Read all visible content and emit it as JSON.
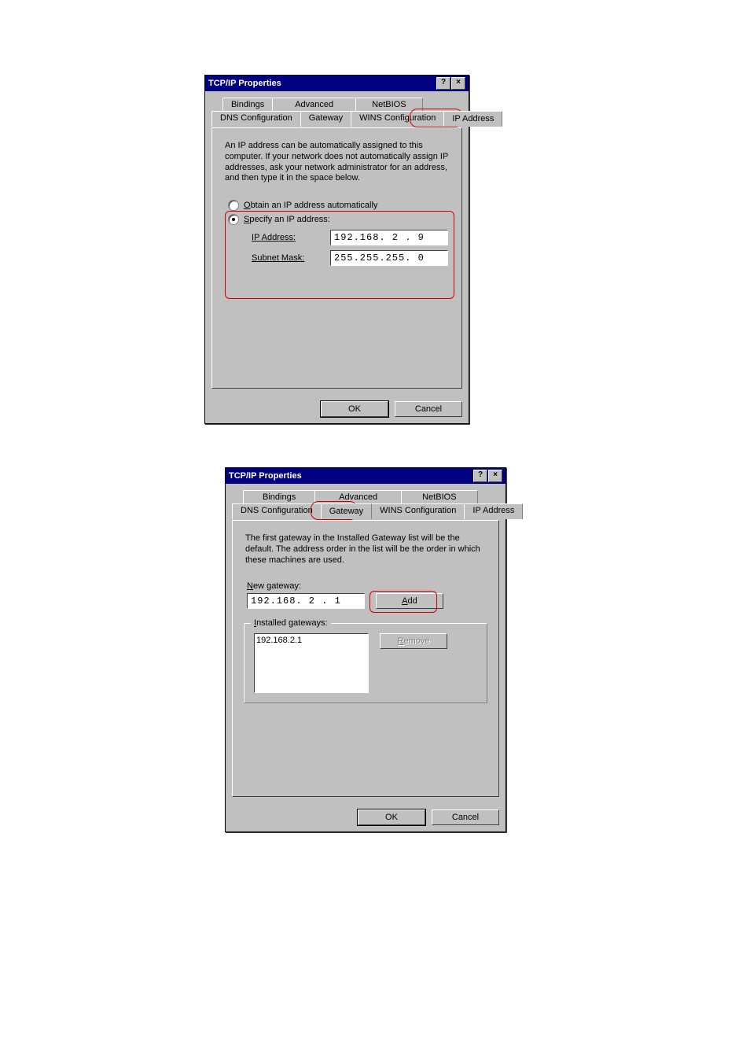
{
  "dialog1": {
    "title": "TCP/IP Properties",
    "tabs_back": [
      "Bindings",
      "Advanced",
      "NetBIOS"
    ],
    "tabs_front": [
      "DNS Configuration",
      "Gateway",
      "WINS Configuration",
      "IP Address"
    ],
    "active_tab": "IP Address",
    "description": "An IP address can be automatically assigned to this computer. If your network does not automatically assign IP addresses, ask your network administrator for an address, and then type it in the space below.",
    "radio_auto": "Obtain an IP address automatically",
    "radio_specify": "Specify an IP address:",
    "ip_label": "IP Address:",
    "ip_value": "192.168. 2 . 9",
    "subnet_label": "Subnet Mask:",
    "subnet_value": "255.255.255. 0",
    "ok": "OK",
    "cancel": "Cancel"
  },
  "dialog2": {
    "title": "TCP/IP Properties",
    "tabs_back": [
      "Bindings",
      "Advanced",
      "NetBIOS"
    ],
    "tabs_front": [
      "DNS Configuration",
      "Gateway",
      "WINS Configuration",
      "IP Address"
    ],
    "active_tab": "Gateway",
    "description": "The first gateway in the Installed Gateway list will be the default. The address order in the list will be the order in which these machines are used.",
    "new_gateway_label": "New gateway:",
    "new_gateway_value": "192.168. 2 . 1",
    "add": "Add",
    "installed_label": "Installed gateways:",
    "installed_item": "192.168.2.1",
    "remove": "Remove",
    "ok": "OK",
    "cancel": "Cancel"
  }
}
